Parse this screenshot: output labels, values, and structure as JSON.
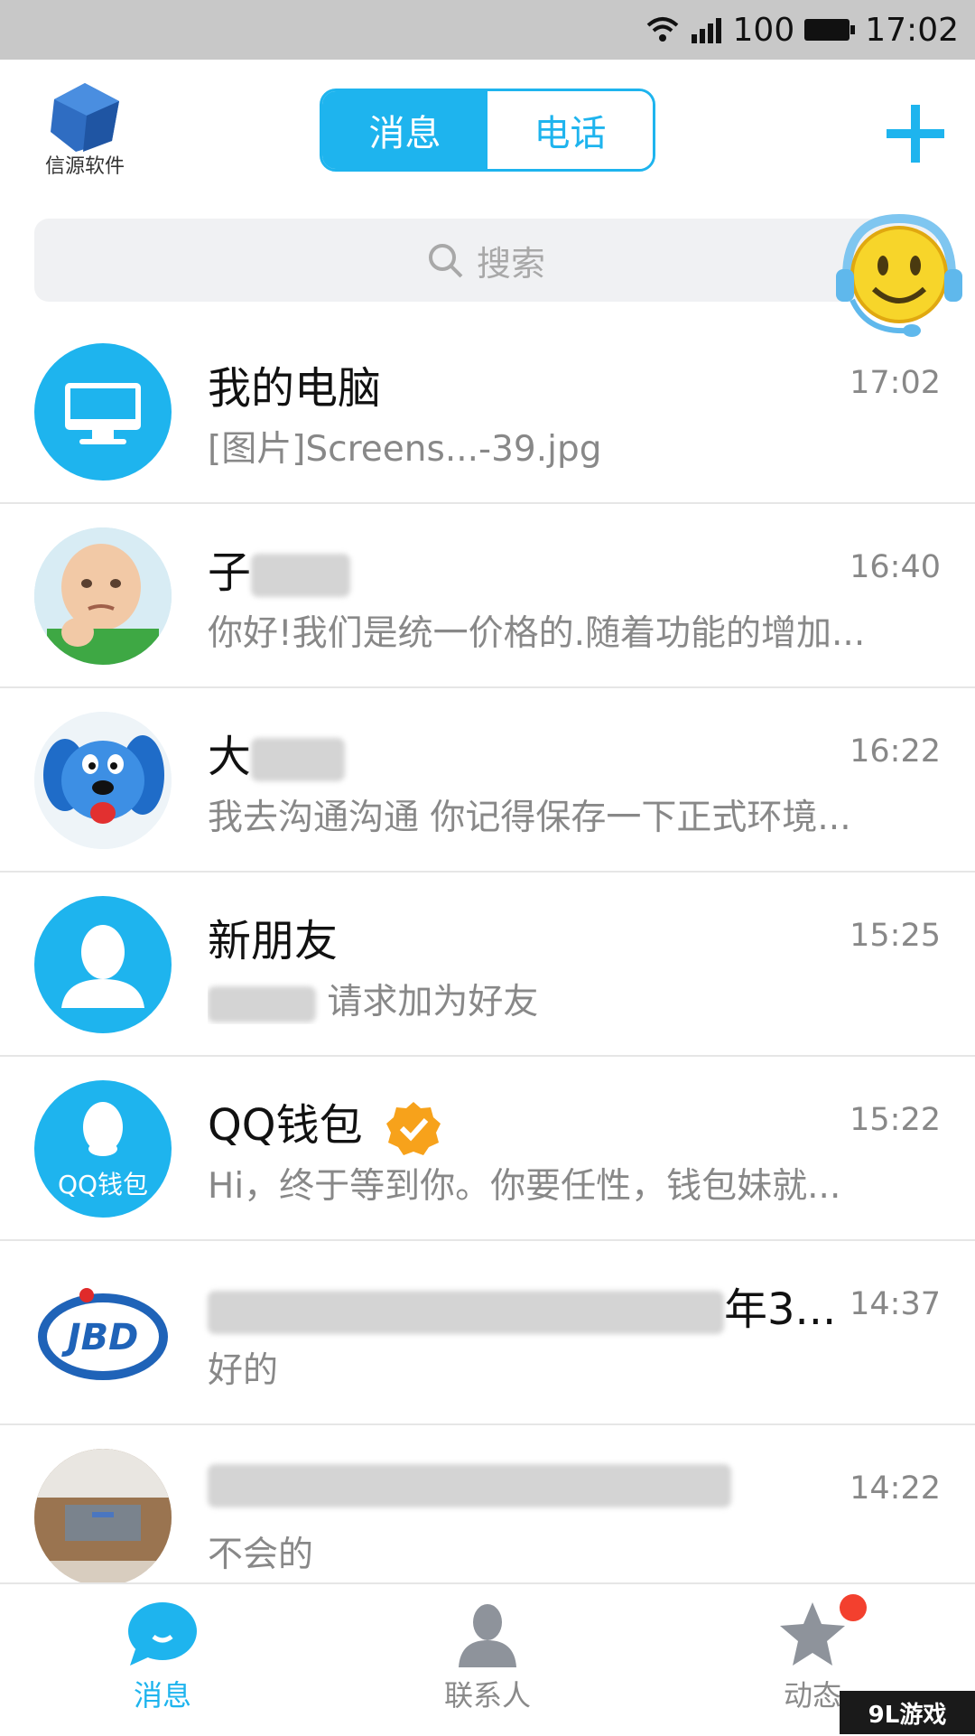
{
  "status_bar": {
    "battery": "100",
    "time": "17:02"
  },
  "header": {
    "logo_text": "信源软件",
    "tabs": [
      {
        "label": "消息",
        "active": true
      },
      {
        "label": "电话",
        "active": false
      }
    ]
  },
  "search": {
    "placeholder": "搜索"
  },
  "conversations": [
    {
      "name": "我的电脑",
      "time": "17:02",
      "preview": "[图片]Screens...-39.jpg"
    },
    {
      "name": "子",
      "time": "16:40",
      "preview": "你好!我们是统一价格的.随着功能的增加..."
    },
    {
      "name": "大",
      "time": "16:22",
      "preview": "我去沟通沟通  你记得保存一下正式环境..."
    },
    {
      "name": "新朋友",
      "time": "15:25",
      "preview": "请求加为好友"
    },
    {
      "name": "QQ钱包",
      "time": "15:22",
      "preview": "Hi，终于等到你。你要任性，钱包妹就...",
      "avatar_text": "QQ钱包"
    },
    {
      "name": "年3...",
      "time": "14:37",
      "preview": "好的",
      "avatar_text": "JBD"
    },
    {
      "name": "",
      "time": "14:22",
      "preview": "不会的"
    }
  ],
  "tabbar": {
    "items": [
      {
        "label": "消息",
        "active": true
      },
      {
        "label": "联系人",
        "active": false
      },
      {
        "label": "动态",
        "active": false,
        "has_badge": true
      }
    ]
  },
  "watermark": "9L游戏",
  "colors": {
    "accent": "#1eb4ee",
    "badge": "#f3402e"
  }
}
